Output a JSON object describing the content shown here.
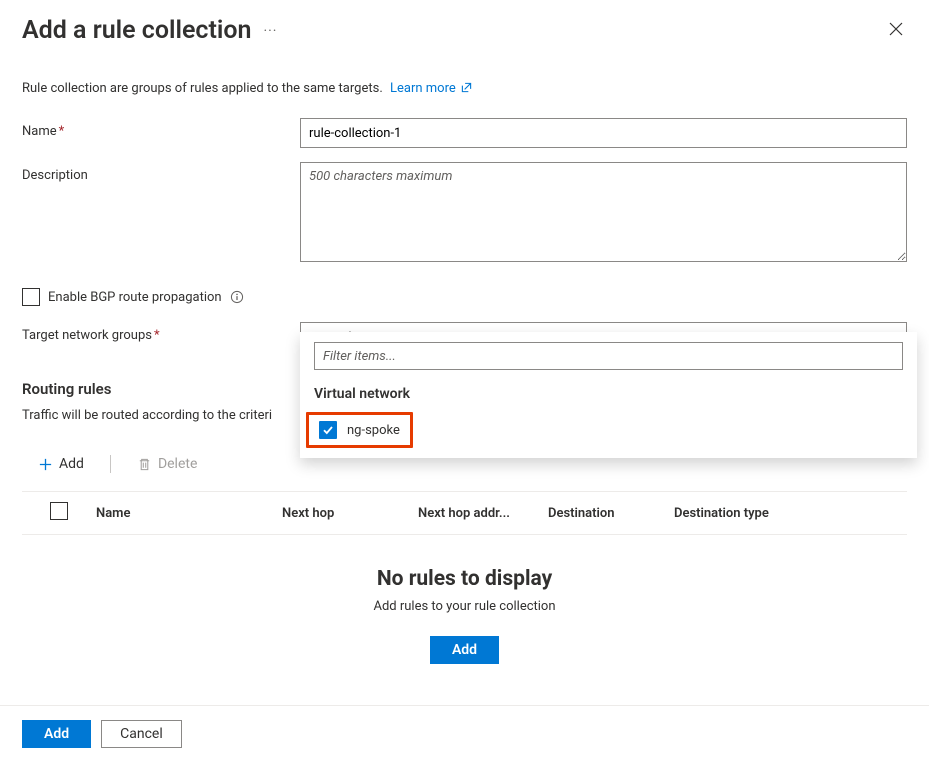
{
  "header": {
    "title": "Add a rule collection"
  },
  "intro": {
    "text": "Rule collection are groups of rules applied to the same targets.",
    "learn_more": "Learn more"
  },
  "form": {
    "name_label": "Name",
    "name_value": "rule-collection-1",
    "description_label": "Description",
    "description_placeholder": "500 characters maximum",
    "bgp_label": "Enable BGP route propagation",
    "target_label": "Target network groups",
    "target_value": "ng-spoke"
  },
  "dropdown": {
    "filter_placeholder": "Filter items...",
    "group_label": "Virtual network",
    "option_label": "ng-spoke"
  },
  "routing": {
    "section_title": "Routing rules",
    "description": "Traffic will be routed according to the criteri",
    "add_label": "Add",
    "delete_label": "Delete",
    "columns": {
      "name": "Name",
      "next_hop": "Next hop",
      "next_hop_addr": "Next hop addr...",
      "destination": "Destination",
      "destination_type": "Destination type"
    },
    "empty_title": "No rules to display",
    "empty_sub": "Add rules to your rule collection",
    "empty_add": "Add"
  },
  "footer": {
    "add": "Add",
    "cancel": "Cancel"
  }
}
